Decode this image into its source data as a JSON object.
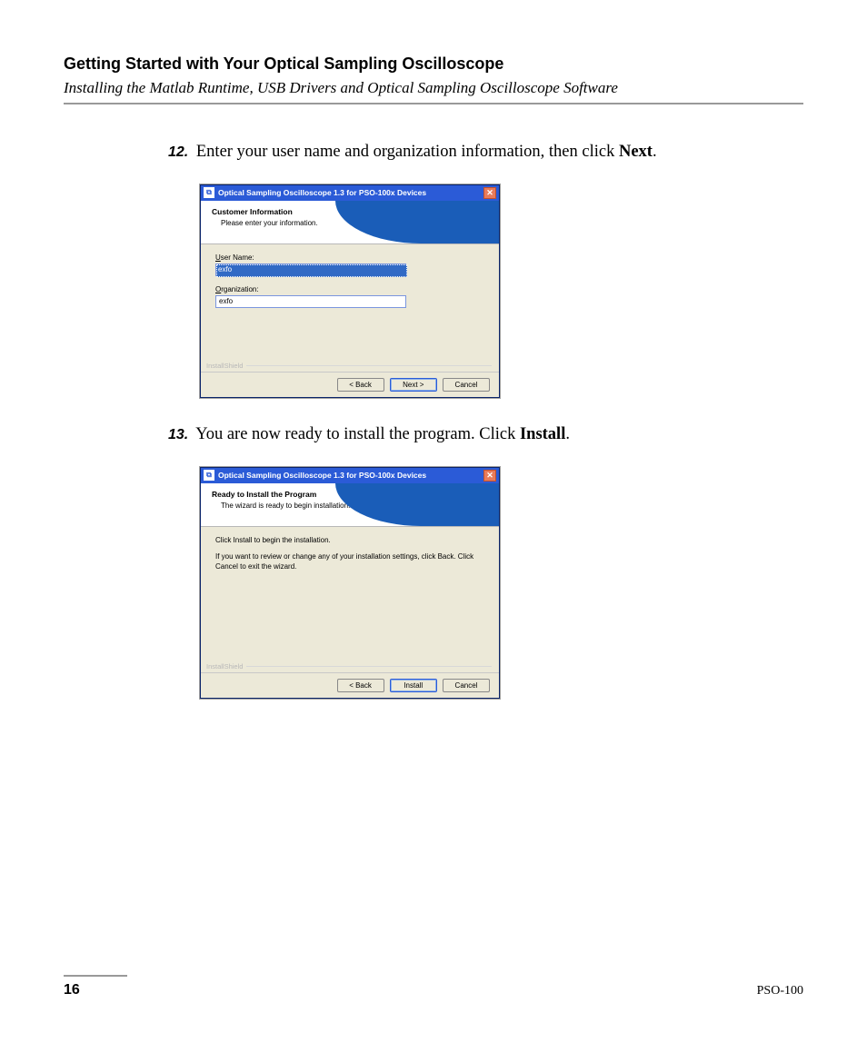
{
  "header": {
    "chapter": "Getting Started with Your Optical Sampling Oscilloscope",
    "section": "Installing the Matlab Runtime, USB Drivers and Optical Sampling Oscilloscope Software"
  },
  "steps": {
    "s12": {
      "num": "12.",
      "text_a": "Enter your user name and organization information, then click ",
      "text_bold": "Next",
      "text_b": "."
    },
    "s13": {
      "num": "13.",
      "text_a": "You are now ready to install the program. Click ",
      "text_bold": "Install",
      "text_b": "."
    }
  },
  "dialog1": {
    "title": "Optical Sampling Oscilloscope 1.3 for PSO-100x Devices",
    "banner_title": "Customer Information",
    "banner_sub": "Please enter your information.",
    "username_label": "User Name:",
    "username_value": "exfo",
    "org_label": "Organization:",
    "org_value": "exfo",
    "install_shield": "InstallShield",
    "btn_back": "< Back",
    "btn_next": "Next >",
    "btn_cancel": "Cancel"
  },
  "dialog2": {
    "title": "Optical Sampling Oscilloscope 1.3 for PSO-100x Devices",
    "banner_title": "Ready to Install the Program",
    "banner_sub": "The wizard is ready to begin installation.",
    "body_line1": "Click Install to begin the installation.",
    "body_line2": "If you want to review or change any of your installation settings, click Back. Click Cancel to exit the wizard.",
    "install_shield": "InstallShield",
    "btn_back": "< Back",
    "btn_install": "Install",
    "btn_cancel": "Cancel"
  },
  "footer": {
    "page": "16",
    "product": "PSO-100"
  }
}
